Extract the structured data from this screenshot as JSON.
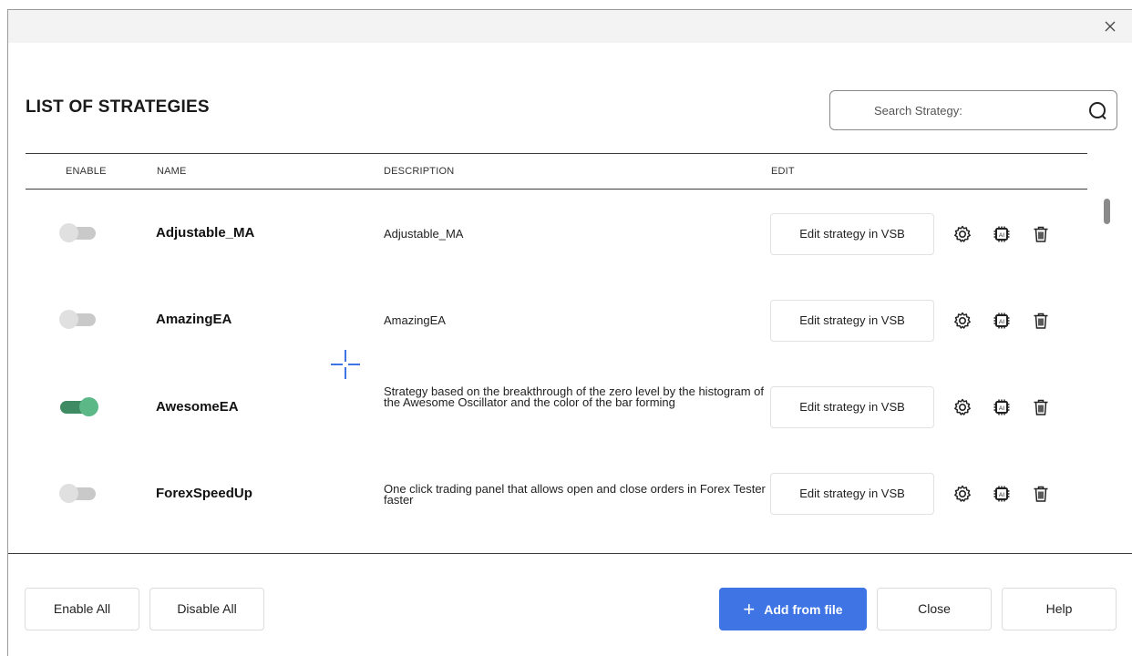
{
  "dialog": {
    "title": "LIST OF STRATEGIES"
  },
  "search": {
    "placeholder": "Search Strategy:"
  },
  "columns": {
    "enable": "ENABLE",
    "name": "NAME",
    "description": "DESCRIPTION",
    "edit": "EDIT"
  },
  "strategies": [
    {
      "enabled": false,
      "name": "Adjustable_MA",
      "description": "Adjustable_MA",
      "edit_label": "Edit strategy in VSB"
    },
    {
      "enabled": false,
      "name": "AmazingEA",
      "description": "AmazingEA",
      "edit_label": "Edit strategy in VSB"
    },
    {
      "enabled": true,
      "name": "AwesomeEA",
      "description": "Strategy based on the breakthrough of the zero level by the histogram of the Awesome Oscillator and the color of the bar forming",
      "edit_label": "Edit strategy in VSB"
    },
    {
      "enabled": false,
      "name": "ForexSpeedUp",
      "description": "One click trading panel that allows open and close orders in Forex Tester faster",
      "edit_label": "Edit strategy in VSB"
    }
  ],
  "footer": {
    "enable_all": "Enable All",
    "disable_all": "Disable All",
    "add_from_file": "Add from file",
    "close": "Close",
    "help": "Help"
  },
  "icons": {
    "close": "close-icon",
    "search": "search-icon",
    "settings": "gear-icon",
    "ai": "ai-chip-icon",
    "delete": "trash-icon",
    "add": "plus-icon",
    "cursor": "crosshair-cursor"
  },
  "colors": {
    "accent": "#3e74e3",
    "toggle_on": "#5cb987",
    "toggle_off": "#e0e0e0"
  }
}
